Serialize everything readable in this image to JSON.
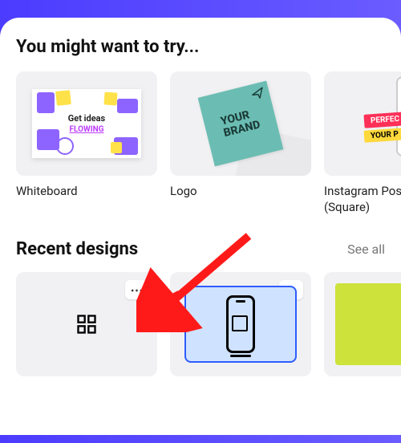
{
  "sections": {
    "try_title": "You might want to try...",
    "recent_title": "Recent designs",
    "see_all": "See all"
  },
  "suggestions": [
    {
      "label": "Whiteboard",
      "thumb_type": "whiteboard",
      "wb_line1": "Get ideas",
      "wb_line2": "FLOWING"
    },
    {
      "label": "Logo",
      "thumb_type": "logo",
      "logo_line1": "YOUR",
      "logo_line2": "BRAND"
    },
    {
      "label": "Instagram Post (Square)",
      "thumb_type": "instagram",
      "badge1": "PERFEC",
      "badge2": "YOUR P"
    }
  ],
  "recent": [
    {
      "type": "grid"
    },
    {
      "type": "phone"
    },
    {
      "type": "green"
    }
  ],
  "colors": {
    "purple": "#8d64ff",
    "yellow": "#ffe24a",
    "teal": "#6bbdb3",
    "blue_tile": "#cfe2ff",
    "green_tile": "#cde23a"
  },
  "menu_dots": "⋯"
}
